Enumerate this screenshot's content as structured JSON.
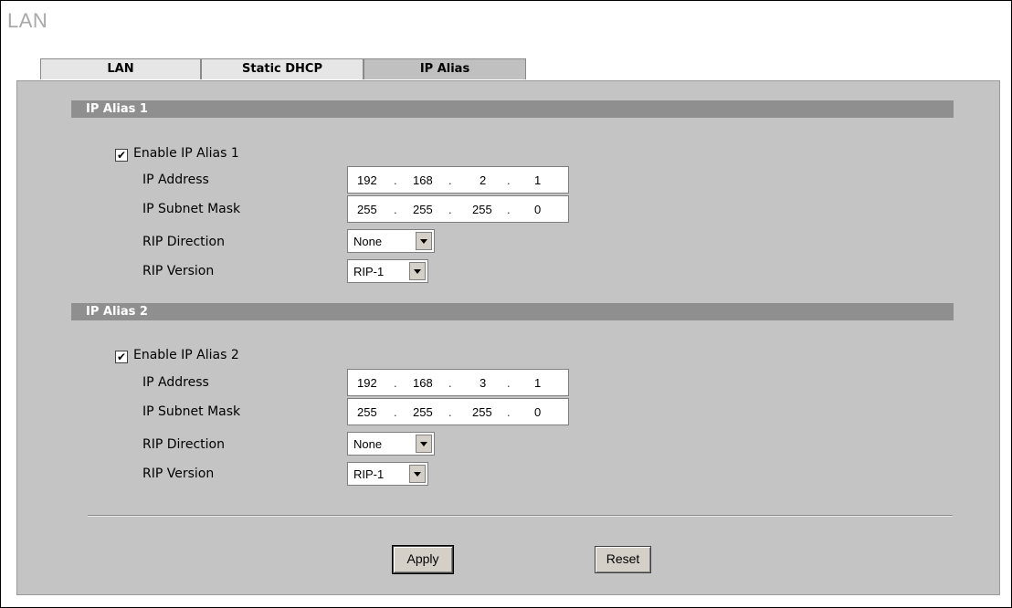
{
  "page": {
    "title": "LAN"
  },
  "tabs": [
    {
      "label": "LAN",
      "active": false
    },
    {
      "label": "Static DHCP",
      "active": false
    },
    {
      "label": "IP Alias",
      "active": true
    }
  ],
  "aliases": [
    {
      "section_title": "IP Alias 1",
      "enable_label": "Enable IP Alias 1",
      "enabled": true,
      "ip_label": "IP Address",
      "ip": [
        "192",
        "168",
        "2",
        "1"
      ],
      "mask_label": "IP Subnet Mask",
      "mask": [
        "255",
        "255",
        "255",
        "0"
      ],
      "rip_dir_label": "RIP Direction",
      "rip_dir": "None",
      "rip_ver_label": "RIP Version",
      "rip_ver": "RIP-1"
    },
    {
      "section_title": "IP Alias 2",
      "enable_label": "Enable IP Alias 2",
      "enabled": true,
      "ip_label": "IP Address",
      "ip": [
        "192",
        "168",
        "3",
        "1"
      ],
      "mask_label": "IP Subnet Mask",
      "mask": [
        "255",
        "255",
        "255",
        "0"
      ],
      "rip_dir_label": "RIP Direction",
      "rip_dir": "None",
      "rip_ver_label": "RIP Version",
      "rip_ver": "RIP-1"
    }
  ],
  "buttons": {
    "apply": "Apply",
    "reset": "Reset"
  },
  "colors": {
    "panel": "#c4c4c4",
    "section_bar": "#8f8f8f",
    "title": "#a9a9a9"
  }
}
